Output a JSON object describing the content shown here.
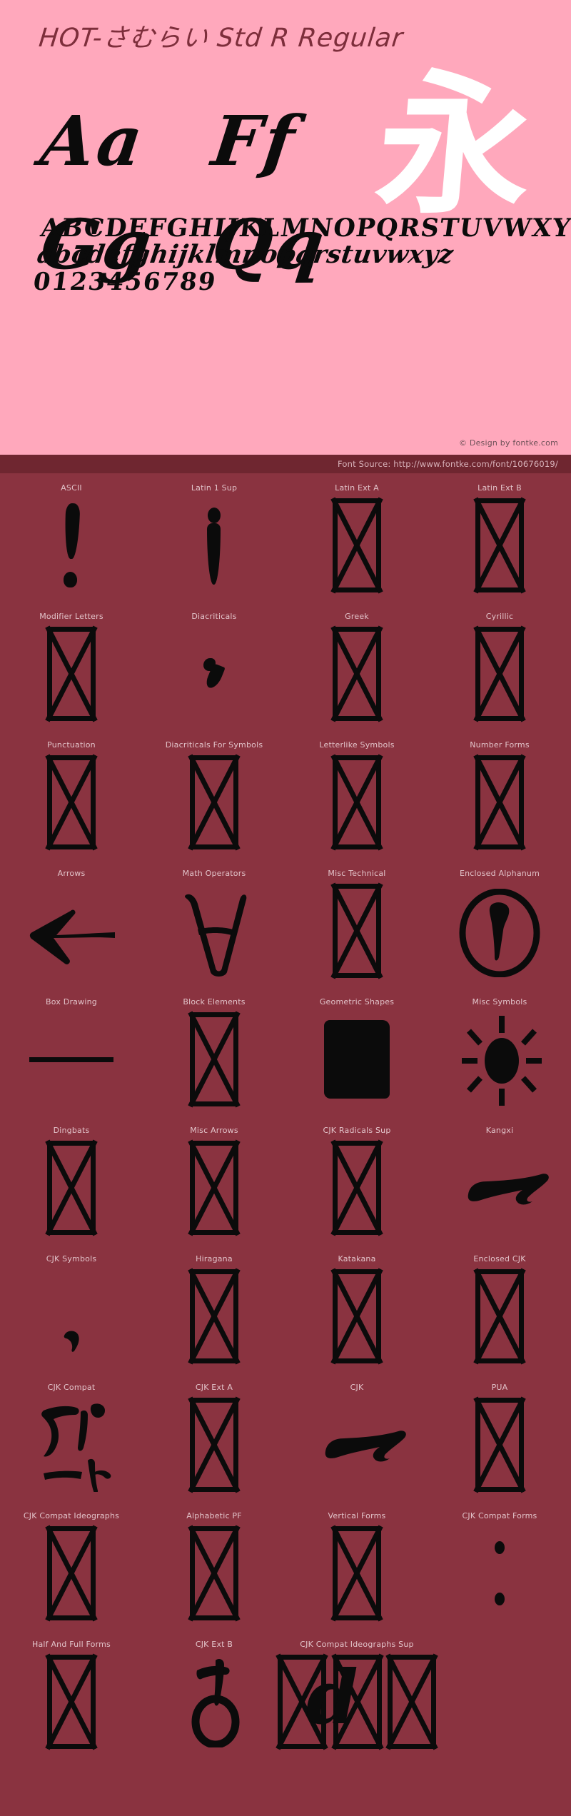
{
  "theme": {
    "pink_bg": "#ffa8bc",
    "dark_bg": "#8a3340",
    "source_bar_bg": "#6f2630",
    "glyph_color": "#000000",
    "title_color": "#7d2e3b",
    "label_color": "#e2c3c9",
    "credit_color": "#6e5158",
    "kanji_color": "#ffffff"
  },
  "header": {
    "font_title": "HOT-さむらい Std R Regular"
  },
  "specimen": {
    "pairs": [
      [
        "Aa",
        "Ff"
      ],
      [
        "Gg",
        "Qq"
      ]
    ],
    "kanji_sample": "永",
    "uppercase": "ABCDEFGHIJKLMNOPQRSTUVWXYZ",
    "lowercase": "abcdefghijklmnopqrstuvwxyz",
    "digits": "0123456789",
    "credit": "© Design by fontke.com"
  },
  "source": {
    "label": "Font Source: http://www.fontke.com/font/10676019/"
  },
  "coverage": {
    "blocks": [
      {
        "label": "ASCII",
        "art": "exclam"
      },
      {
        "label": "Latin 1 Sup",
        "art": "quote"
      },
      {
        "label": "Latin Ext A",
        "art": "notdef"
      },
      {
        "label": "Latin Ext B",
        "art": "notdef"
      },
      {
        "label": "Modifier Letters",
        "art": "notdef"
      },
      {
        "label": "Diacriticals",
        "art": "comma"
      },
      {
        "label": "Greek",
        "art": "notdef"
      },
      {
        "label": "Cyrillic",
        "art": "notdef"
      },
      {
        "label": "Punctuation",
        "art": "notdef"
      },
      {
        "label": "Diacriticals For Symbols",
        "art": "notdef"
      },
      {
        "label": "Letterlike Symbols",
        "art": "notdef"
      },
      {
        "label": "Number Forms",
        "art": "notdef"
      },
      {
        "label": "Arrows",
        "art": "arrow-left"
      },
      {
        "label": "Math Operators",
        "art": "forall"
      },
      {
        "label": "Misc Technical",
        "art": "notdef"
      },
      {
        "label": "Enclosed Alphanum",
        "art": "circled-exclam"
      },
      {
        "label": "Box Drawing",
        "art": "hline"
      },
      {
        "label": "Block Elements",
        "art": "notdef"
      },
      {
        "label": "Geometric Shapes",
        "art": "filled-square"
      },
      {
        "label": "Misc Symbols",
        "art": "sun"
      },
      {
        "label": "Dingbats",
        "art": "notdef"
      },
      {
        "label": "Misc Arrows",
        "art": "notdef"
      },
      {
        "label": "CJK Radicals Sup",
        "art": "notdef"
      },
      {
        "label": "Kangxi",
        "art": "brush-stroke"
      },
      {
        "label": "CJK Symbols",
        "art": "small-tick"
      },
      {
        "label": "Hiragana",
        "art": "notdef"
      },
      {
        "label": "Katakana",
        "art": "notdef"
      },
      {
        "label": "Enclosed CJK",
        "art": "notdef"
      },
      {
        "label": "CJK Compat",
        "art": "katakana-art"
      },
      {
        "label": "CJK Ext A",
        "art": "notdef"
      },
      {
        "label": "CJK",
        "art": "brush-stroke"
      },
      {
        "label": "PUA",
        "art": "notdef"
      },
      {
        "label": "CJK Compat Ideographs",
        "art": "notdef"
      },
      {
        "label": "Alphabetic PF",
        "art": "notdef"
      },
      {
        "label": "Vertical Forms",
        "art": "notdef"
      },
      {
        "label": "CJK Compat Forms",
        "art": "two-dots"
      },
      {
        "label": "Half And Full Forms",
        "art": "notdef"
      },
      {
        "label": "CJK Ext B",
        "art": "glyph-d"
      },
      {
        "label": "CJK Compat Ideographs Sup",
        "art": "overlap-triple"
      }
    ]
  }
}
